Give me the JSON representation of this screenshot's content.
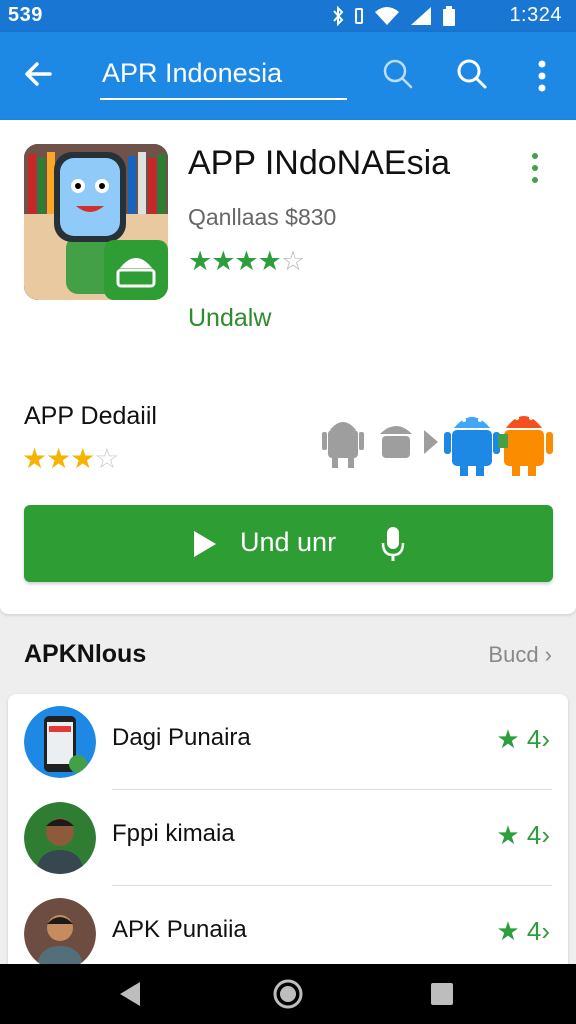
{
  "status_bar": {
    "left_time": "539",
    "clock": "1:324"
  },
  "app_bar": {
    "title": "APR Indonesia",
    "icons": [
      "back-arrow-icon",
      "search-icon",
      "search-icon",
      "more-vert-icon"
    ]
  },
  "app": {
    "name": "APP INdoNAEsia",
    "subtitle": "Qanllaas $830",
    "stars_full": "★★★★",
    "stars_half": "☆",
    "install_text": "Undalw"
  },
  "detail": {
    "title": "APP Dedaiil",
    "stars_full": "★★★",
    "stars_half": "☆"
  },
  "install_button": {
    "label": "Und  unr"
  },
  "section": {
    "title": "APKNlous",
    "more": "Bucd ›"
  },
  "list": [
    {
      "name": "Dagi Punaira",
      "badge": "★ 4›"
    },
    {
      "name": "Fppi kimaia",
      "badge": "★ 4›"
    },
    {
      "name": "APK Punaiia",
      "badge": "★ 4›"
    }
  ],
  "colors": {
    "primary": "#1e88e5",
    "status": "#1976d2",
    "accent_green": "#2e9e34",
    "star_gold": "#f5b400"
  }
}
